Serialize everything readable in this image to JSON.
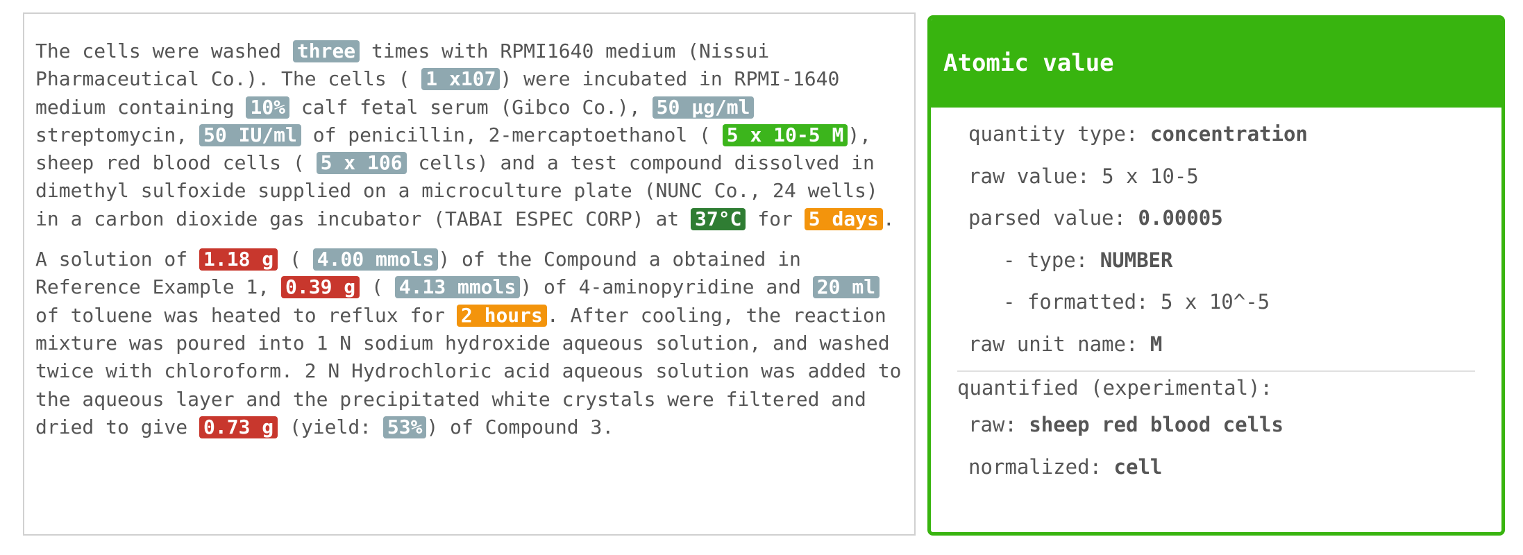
{
  "paragraph1": {
    "s1": "The cells were washed ",
    "t1": "three",
    "s2": " times with RPMI1640 medium (Nissui Pharmaceutical Co.). The cells ( ",
    "t2": "1 x107",
    "s3": ") were incubated in RPMI-1640 medium containing ",
    "t3": "10%",
    "s4": " calf fetal serum (Gibco Co.), ",
    "t4": "50 µg/ml",
    "s5": " streptomycin, ",
    "t5": "50 IU/ml",
    "s6": " of penicillin, 2-mercaptoethanol ( ",
    "t6": "5 x 10-5 M",
    "s7": "), sheep red blood cells ( ",
    "t7": "5 x 106",
    "s8": " cells) and a test compound dissolved in dimethyl sulfoxide supplied on a microculture plate (NUNC Co., 24 wells) in a carbon dioxide gas incubator (TABAI ESPEC CORP) at ",
    "t8": "37°C",
    "s9": " for ",
    "t9": "5 days",
    "s10": "."
  },
  "paragraph2": {
    "s1": "A solution of ",
    "t1": "1.18 g",
    "s2": " ( ",
    "t2": "4.00 mmols",
    "s3": ") of the Compound a obtained in Reference Example 1, ",
    "t3": "0.39 g",
    "s4": " ( ",
    "t4": "4.13 mmols",
    "s5": ") of 4-aminopyridine and ",
    "t5": "20 ml",
    "s6": " of toluene was heated to reflux for ",
    "t6": "2 hours",
    "s7": ". After cooling, the reaction mixture was poured into 1 N sodium hydroxide aqueous solution, and washed twice with chloroform. 2 N Hydrochloric acid aqueous solution was added to the aqueous layer and the precipitated white crystals were filtered and dried to give ",
    "t7": "0.73 g",
    "s8": " (yield: ",
    "t8": "53%",
    "s9": ") of Compound 3."
  },
  "colors": {
    "gray": "#8fa8b0",
    "green": "#3cb51c",
    "dark_green": "#2f7d33",
    "orange": "#f3940c",
    "red": "#c8372d",
    "panel_green": "#38b40f"
  },
  "panel": {
    "title": "Atomic value",
    "quantity_type_label": "quantity type:",
    "quantity_type_value": "concentration",
    "raw_value_label": "raw value:",
    "raw_value_value": "5 x 10-5",
    "parsed_value_label": "parsed value:",
    "parsed_value_value": "0.00005",
    "type_label": "- type:",
    "type_value": "NUMBER",
    "formatted_label": "- formatted:",
    "formatted_value": "5 x 10^-5",
    "raw_unit_label": "raw unit name:",
    "raw_unit_value": "M",
    "quantified_title": "quantified (experimental):",
    "raw_label": "raw:",
    "raw_value": "sheep red blood cells",
    "normalized_label": "normalized:",
    "normalized_value": "cell"
  }
}
